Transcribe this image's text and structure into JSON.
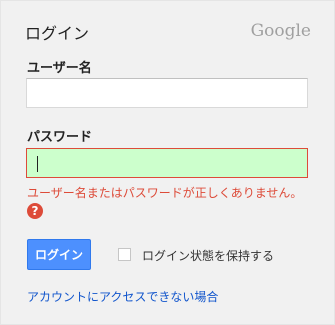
{
  "header": {
    "title": "ログイン",
    "brand": "Google"
  },
  "form": {
    "username_label": "ユーザー名",
    "username_value": "",
    "password_label": "パスワード",
    "password_value": "",
    "error_message": "ユーザー名またはパスワードが正しくありません。",
    "help_icon_glyph": "?",
    "signin_button": "ログイン",
    "stay_signed_in_label": "ログイン状態を保持する",
    "stay_signed_in_checked": false,
    "cant_access_link": "アカウントにアクセスできない場合"
  },
  "colors": {
    "accent": "#4d90fe",
    "error": "#dd4b39",
    "link": "#1155cc",
    "password_field_bg": "#ccffcc"
  },
  "icons": {
    "help": "help-question-icon"
  }
}
